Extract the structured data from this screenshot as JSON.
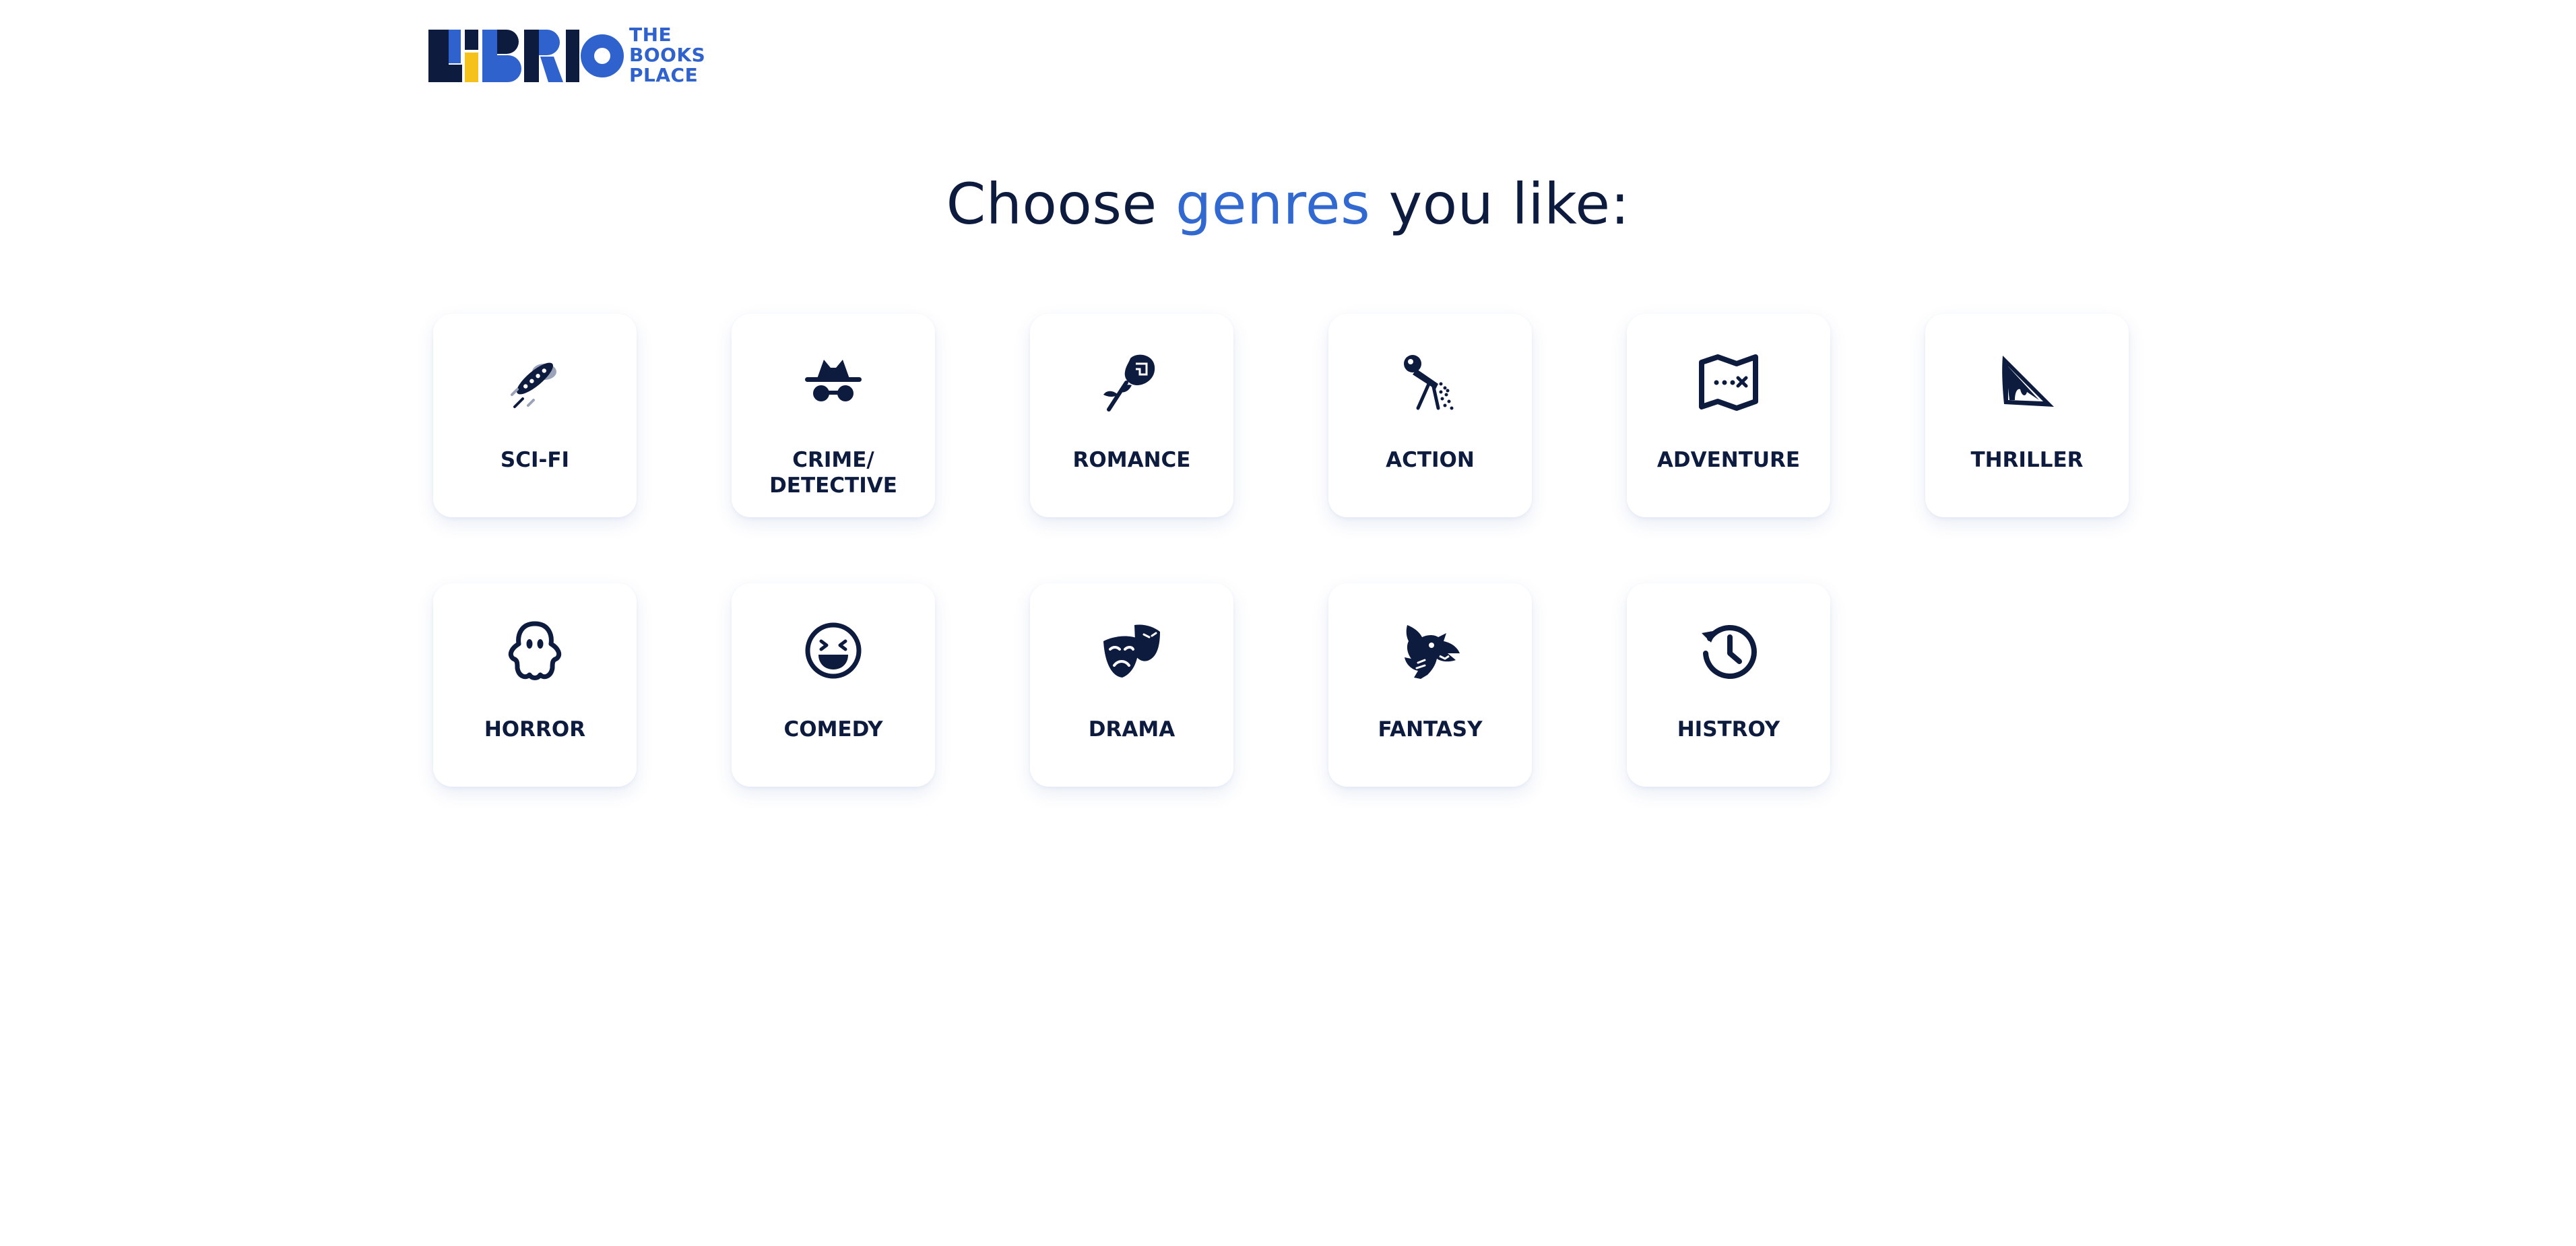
{
  "brand": {
    "logo_text": "LIBRIO",
    "tagline_lines": [
      "THE",
      "BOOKS",
      "PLACE"
    ]
  },
  "heading": {
    "prefix": "Choose",
    "accent": "genres",
    "suffix": "you like:"
  },
  "genres": [
    {
      "label": "SCI-FI",
      "icon": "ufo-icon"
    },
    {
      "label": "CRIME/\nDETECTIVE",
      "icon": "spy-icon"
    },
    {
      "label": "ROMANCE",
      "icon": "rose-icon"
    },
    {
      "label": "ACTION",
      "icon": "machine-gun-icon"
    },
    {
      "label": "ADVENTURE",
      "icon": "treasure-map-icon"
    },
    {
      "label": "THRILLER",
      "icon": "bloody-knife-icon"
    },
    {
      "label": "HORROR",
      "icon": "ghost-icon"
    },
    {
      "label": "COMEDY",
      "icon": "laughing-face-icon"
    },
    {
      "label": "DRAMA",
      "icon": "theater-masks-icon"
    },
    {
      "label": "FANTASY",
      "icon": "dragon-head-icon"
    },
    {
      "label": "HISTROY",
      "icon": "history-clock-icon"
    }
  ],
  "colors": {
    "text_dark": "#0d1b3f",
    "accent_blue": "#3169d1",
    "logo_blue": "#2f62cc",
    "logo_yellow": "#f4c21b"
  }
}
